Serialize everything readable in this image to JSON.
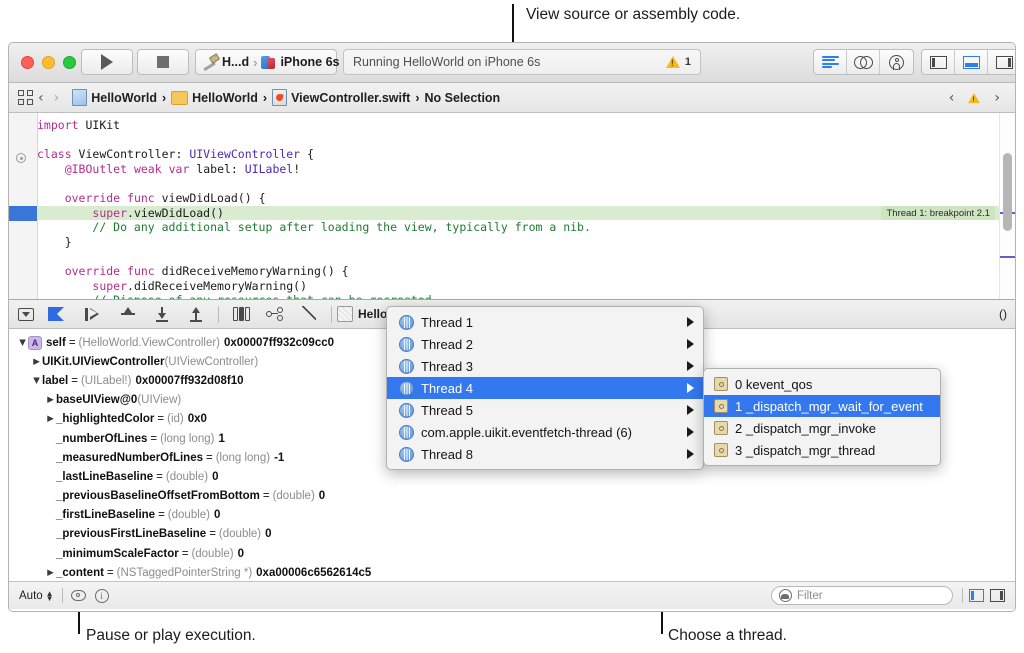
{
  "annotations": {
    "top": "View source or assembly code.",
    "bottom_left": "Pause or play execution.",
    "bottom_right": "Choose a thread."
  },
  "toolbar": {
    "scheme_name": "H...d",
    "scheme_separator": "›",
    "destination": "iPhone 6s",
    "status": "Running HelloWorld on iPhone 6s",
    "warning_count": "1",
    "run_label": "run",
    "stop_label": "stop",
    "editor_modes": [
      "standard-editor",
      "assistant-editor",
      "version-editor"
    ],
    "pane_toggles": [
      "navigator-pane",
      "debug-pane",
      "utilities-pane"
    ]
  },
  "jumpbar": {
    "crumbs": [
      "HelloWorld",
      "HelloWorld",
      "ViewController.swift",
      "No Selection"
    ],
    "separator": "›",
    "back": "‹",
    "forward": "›",
    "issue_prev": "‹",
    "issue_next": "›"
  },
  "editor": {
    "lines": [
      {
        "i": 0,
        "segments": [
          {
            "t": "import",
            "c": "kw"
          },
          {
            "t": " UIKit",
            "c": ""
          }
        ]
      },
      {
        "i": 1,
        "segments": [
          {
            "t": "",
            "c": ""
          }
        ]
      },
      {
        "i": 2,
        "segments": [
          {
            "t": "class",
            "c": "kw"
          },
          {
            "t": " ViewController: ",
            "c": ""
          },
          {
            "t": "UIViewController",
            "c": "ty"
          },
          {
            "t": " {",
            "c": ""
          }
        ]
      },
      {
        "i": 3,
        "segments": [
          {
            "t": "    ",
            "c": ""
          },
          {
            "t": "@IBOutlet",
            "c": "at"
          },
          {
            "t": " ",
            "c": ""
          },
          {
            "t": "weak",
            "c": "kw"
          },
          {
            "t": " ",
            "c": ""
          },
          {
            "t": "var",
            "c": "kw"
          },
          {
            "t": " label: ",
            "c": ""
          },
          {
            "t": "UILabel",
            "c": "ty"
          },
          {
            "t": "!",
            "c": ""
          }
        ]
      },
      {
        "i": 4,
        "segments": [
          {
            "t": "",
            "c": ""
          }
        ]
      },
      {
        "i": 5,
        "segments": [
          {
            "t": "    ",
            "c": ""
          },
          {
            "t": "override",
            "c": "kw"
          },
          {
            "t": " ",
            "c": ""
          },
          {
            "t": "func",
            "c": "kw"
          },
          {
            "t": " viewDidLoad() {",
            "c": ""
          }
        ]
      },
      {
        "i": 6,
        "segments": [
          {
            "t": "        ",
            "c": ""
          },
          {
            "t": "super",
            "c": "kw"
          },
          {
            "t": ".viewDidLoad()",
            "c": ""
          }
        ],
        "highlight": true
      },
      {
        "i": 7,
        "segments": [
          {
            "t": "        ",
            "c": ""
          },
          {
            "t": "// Do any additional setup after loading the view, typically from a nib.",
            "c": "cm"
          }
        ]
      },
      {
        "i": 8,
        "segments": [
          {
            "t": "    }",
            "c": ""
          }
        ]
      },
      {
        "i": 9,
        "segments": [
          {
            "t": "",
            "c": ""
          }
        ]
      },
      {
        "i": 10,
        "segments": [
          {
            "t": "    ",
            "c": ""
          },
          {
            "t": "override",
            "c": "kw"
          },
          {
            "t": " ",
            "c": ""
          },
          {
            "t": "func",
            "c": "kw"
          },
          {
            "t": " didReceiveMemoryWarning() {",
            "c": ""
          }
        ]
      },
      {
        "i": 11,
        "segments": [
          {
            "t": "        ",
            "c": ""
          },
          {
            "t": "super",
            "c": "kw"
          },
          {
            "t": ".didReceiveMemoryWarning()",
            "c": ""
          }
        ]
      },
      {
        "i": 12,
        "segments": [
          {
            "t": "        ",
            "c": ""
          },
          {
            "t": "// Dispose of any resources that can be recreated.",
            "c": "cm"
          }
        ]
      },
      {
        "i": 13,
        "segments": [
          {
            "t": "    }",
            "c": ""
          }
        ]
      }
    ],
    "breakpoint_badge": "Thread 1: breakpoint 2.1"
  },
  "debugbar": {
    "buttons": [
      "hide-debug-area",
      "deactivate-breakpoints",
      "continue-execution",
      "step-over",
      "step-into",
      "step-out",
      "debug-view-hierarchy",
      "debug-memory-graph",
      "simulate-location"
    ],
    "process_crumb": "HelloWor",
    "frame_crumb": "()"
  },
  "variables": [
    {
      "indent": 0,
      "twisty": "▼",
      "badge": "A",
      "name": "self",
      "eq": "=",
      "type": "(HelloWorld.ViewController)",
      "value": "0x00007ff932c09cc0"
    },
    {
      "indent": 1,
      "twisty": "▶",
      "badge": "",
      "name": "UIKit.UIViewController",
      "eq": "",
      "type": "(UIViewController)",
      "value": ""
    },
    {
      "indent": 1,
      "twisty": "▼",
      "badge": "",
      "name": "label",
      "eq": "=",
      "type": "(UILabel!)",
      "value": "0x00007ff932d08f10"
    },
    {
      "indent": 2,
      "twisty": "▶",
      "badge": "",
      "name": "baseUIView@0",
      "eq": "",
      "type": "(UIView)",
      "value": ""
    },
    {
      "indent": 2,
      "twisty": "▶",
      "badge": "",
      "name": "_highlightedColor",
      "eq": "=",
      "type": "(id)",
      "value": "0x0"
    },
    {
      "indent": 2,
      "twisty": "",
      "badge": "",
      "name": "_numberOfLines",
      "eq": "=",
      "type": "(long long)",
      "value": "1"
    },
    {
      "indent": 2,
      "twisty": "",
      "badge": "",
      "name": "_measuredNumberOfLines",
      "eq": "=",
      "type": "(long long)",
      "value": "-1"
    },
    {
      "indent": 2,
      "twisty": "",
      "badge": "",
      "name": "_lastLineBaseline",
      "eq": "=",
      "type": "(double)",
      "value": "0"
    },
    {
      "indent": 2,
      "twisty": "",
      "badge": "",
      "name": "_previousBaselineOffsetFromBottom",
      "eq": "=",
      "type": "(double)",
      "value": "0"
    },
    {
      "indent": 2,
      "twisty": "",
      "badge": "",
      "name": "_firstLineBaseline",
      "eq": "=",
      "type": "(double)",
      "value": "0"
    },
    {
      "indent": 2,
      "twisty": "",
      "badge": "",
      "name": "_previousFirstLineBaseline",
      "eq": "=",
      "type": "(double)",
      "value": "0"
    },
    {
      "indent": 2,
      "twisty": "",
      "badge": "",
      "name": "_minimumScaleFactor",
      "eq": "=",
      "type": "(double)",
      "value": "0"
    },
    {
      "indent": 2,
      "twisty": "▶",
      "badge": "",
      "name": "_content",
      "eq": "=",
      "type": "(NSTaggedPointerString *)",
      "value": "0xa00006c6562614c5"
    }
  ],
  "thread_menu": {
    "items": [
      {
        "label": "Thread 1",
        "selected": false
      },
      {
        "label": "Thread 2",
        "selected": false
      },
      {
        "label": "Thread 3",
        "selected": false
      },
      {
        "label": "Thread 4",
        "selected": true
      },
      {
        "label": "Thread 5",
        "selected": false
      },
      {
        "label": "com.apple.uikit.eventfetch-thread (6)",
        "selected": false
      },
      {
        "label": "Thread 8",
        "selected": false
      }
    ]
  },
  "frame_menu": {
    "items": [
      {
        "label": "0 kevent_qos",
        "selected": false
      },
      {
        "label": "1 _dispatch_mgr_wait_for_event",
        "selected": true
      },
      {
        "label": "2 _dispatch_mgr_invoke",
        "selected": false
      },
      {
        "label": "3 _dispatch_mgr_thread",
        "selected": false
      }
    ]
  },
  "statusbar": {
    "scope": "Auto",
    "filter_placeholder": "Filter",
    "toggles": [
      "variables-view-toggle",
      "console-view-toggle"
    ]
  },
  "colors": {
    "accent_blue": "#3478f0",
    "warning_yellow": "#f5bb1d",
    "breakpoint_green": "#cfe5c2",
    "exec_blue": "#3a76d8"
  }
}
